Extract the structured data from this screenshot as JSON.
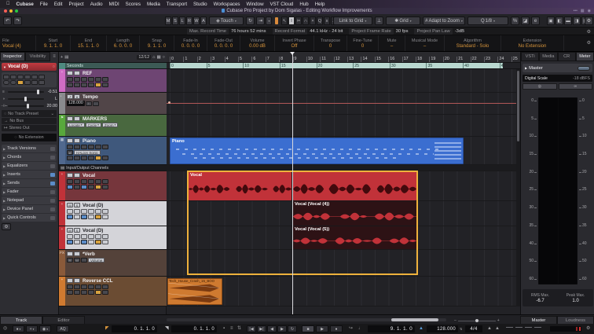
{
  "window": {
    "menu_items": [
      "Cubase",
      "File",
      "Edit",
      "Project",
      "Audio",
      "MIDI",
      "Scores",
      "Media",
      "Transport",
      "Studio",
      "Workspaces",
      "Window",
      "VST Cloud",
      "Hub",
      "Help"
    ],
    "title": "Cubase Pro Project by Dom Sigalas - Editing Workflow Improvements"
  },
  "toolbar": {
    "automation_buttons": [
      "M",
      "S",
      "L",
      "R",
      "W",
      "A"
    ],
    "automation_mode": "Touch",
    "tools": [
      "↖",
      "I",
      "✂",
      "∩",
      "×",
      "Q",
      "x",
      "∕",
      "≈",
      "▷",
      "◧"
    ],
    "link_to_grid": "Link to Grid",
    "grid_mode": "Grid",
    "zoom_mode": "Adapt to Zoom",
    "quantize_label": "Q",
    "quantize_value": "1/8"
  },
  "status_line": {
    "items": [
      {
        "label": "Max. Record Time",
        "value": "76 hours 52 mins"
      },
      {
        "label": "Record Format",
        "value": "44.1 kHz - 24 bit"
      },
      {
        "label": "Project Frame Rate",
        "value": "30 fps"
      },
      {
        "label": "Project Pan Law",
        "value": "-3dB"
      }
    ]
  },
  "info_line": {
    "columns": [
      {
        "label": "File",
        "value": "Vocal (4)"
      },
      {
        "label": "Start",
        "value": "9. 1. 1. 0"
      },
      {
        "label": "End",
        "value": "15. 1. 1. 0"
      },
      {
        "label": "Length",
        "value": "6. 0. 0. 0"
      },
      {
        "label": "Snap",
        "value": "9. 1. 1. 0"
      },
      {
        "label": "Fade-In",
        "value": "0. 0. 0. 0"
      },
      {
        "label": "Fade-Out",
        "value": "0. 0. 0. 0"
      },
      {
        "label": "Volume",
        "value": "0.00 dB"
      },
      {
        "label": "Invert Phase",
        "value": "Off"
      },
      {
        "label": "Transpose",
        "value": "0"
      },
      {
        "label": "Fine-Tune",
        "value": "0"
      },
      {
        "label": "Mute",
        "value": "–"
      },
      {
        "label": "Musical Mode",
        "value": "–"
      },
      {
        "label": "Algorithm",
        "value": "Standard - Solo"
      },
      {
        "label": "Extension",
        "value": "No Extension"
      }
    ]
  },
  "inspector": {
    "tabs": [
      "Inspector",
      "Visibility"
    ],
    "track_name": "Vocal (D)",
    "volume": "-0.51",
    "pan": "L",
    "delay": "20.00",
    "track_preset": "No Track Preset",
    "input_routing": "No Bus",
    "output_routing": "Stereo Out",
    "extension": "No Extension",
    "sections": [
      "Track Versions",
      "Chords",
      "Equalizers",
      "Inserts",
      "Sends",
      "Fader",
      "Notepad",
      "Device Panel",
      "Quick Controls"
    ],
    "bottom_tabs": [
      "Track",
      "Editor"
    ]
  },
  "tracklist": {
    "visible_count": "12/12",
    "ruler_track": "Seconds",
    "io_divider": "Input/Output Channels",
    "tempo_value": "128.000",
    "marker_buttons": [
      "Locate",
      "Cycle",
      "Zoom"
    ],
    "piano_instrument": "HALion Sonic",
    "verb_volume_label": "Volume",
    "fx_label": "FX",
    "tracks": {
      "ref": "REF",
      "tempo": "Tempo",
      "markers": "MARKERS",
      "piano": "Piano",
      "vocal": "Vocal",
      "vocal_d1": "Vocal (D)",
      "vocal_d2": "Vocal (D)",
      "verb": "*Verb",
      "reverse": "Reverse CCL"
    }
  },
  "ruler": {
    "bars": [
      "0",
      "1",
      "2",
      "3",
      "4",
      "5",
      "6",
      "7",
      "8",
      "9",
      "10",
      "11",
      "12",
      "13",
      "14",
      "15",
      "16",
      "17",
      "18",
      "19",
      "20",
      "21",
      "22",
      "23",
      "24",
      "25"
    ],
    "seconds": [
      "0",
      "5",
      "10",
      "15",
      "20",
      "25",
      "30",
      "35",
      "40",
      "45"
    ]
  },
  "clips": {
    "piano": "Piano",
    "vocal": "Vocal",
    "vocal4": "Vocal (Vocal (4))",
    "vocal5": "Vocal (Vocal (5))",
    "crash": "Tech_House_Crash_15_BOO"
  },
  "right_zone": {
    "tabs": [
      "VSTi",
      "Media",
      "CR",
      "Meter"
    ],
    "master": "Master",
    "digital_scale_label": "Digital Scale",
    "digital_scale_value": "-18 dBFS",
    "meter_ticks": [
      "0",
      "5",
      "10",
      "15",
      "20",
      "25",
      "30",
      "35",
      "40",
      "50",
      "60"
    ],
    "rms_label": "RMS Max.",
    "rms_value": "-6.7",
    "peak_label": "Peak Max.",
    "peak_value": "1.0",
    "bottom_tabs": [
      "Master",
      "Loudness"
    ]
  },
  "transport": {
    "aq": "AQ",
    "left_locator": "0. 1. 1. 0",
    "right_locator": "0. 1. 1. 0",
    "position": "9. 1. 1. 0",
    "tempo": "128.000",
    "time_signature": "4/4"
  },
  "colors": {
    "accent_orange": "#d9963c",
    "selection_yellow": "#eeb13c",
    "clip_red": "#c13239",
    "clip_blue": "#3b6ed0",
    "clip_orange": "#cf7a30"
  }
}
